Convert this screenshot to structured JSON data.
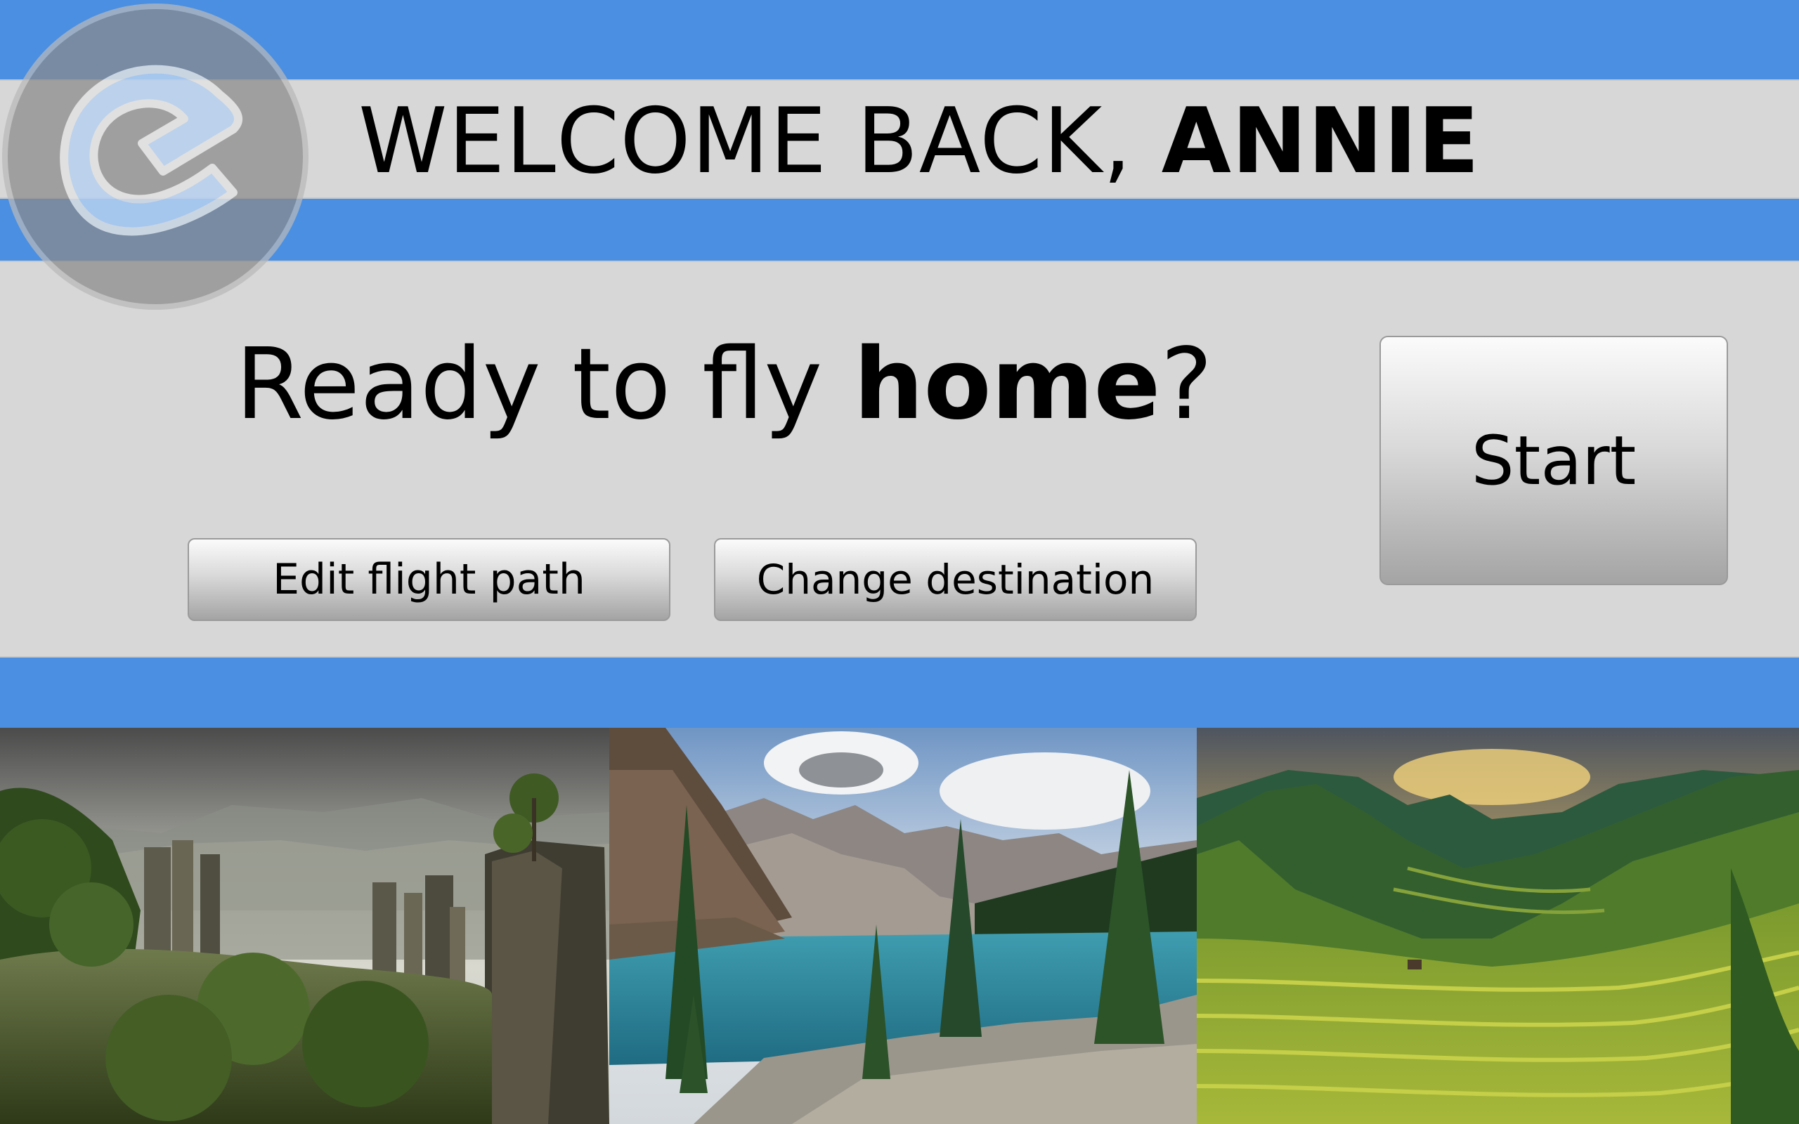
{
  "header": {
    "greeting": "WELCOME BACK,",
    "user_name": "ANNIE"
  },
  "prompt": {
    "lead": "Ready to fly",
    "destination": "home",
    "punctuation": "?"
  },
  "buttons": {
    "edit_flight_path": "Edit flight path",
    "change_destination": "Change destination",
    "start": "Start"
  },
  "gallery": {
    "photos": [
      {
        "scene": "karst pillar mountains with misty forest"
      },
      {
        "scene": "turquoise mountain lake with pine trees"
      },
      {
        "scene": "green rice terraces in mountain valley at sunset"
      }
    ]
  },
  "logo": {
    "icon": "app-logo-icon"
  },
  "colors": {
    "accent_blue": "#4a8fe2",
    "panel_gray": "#d7d7d7"
  }
}
